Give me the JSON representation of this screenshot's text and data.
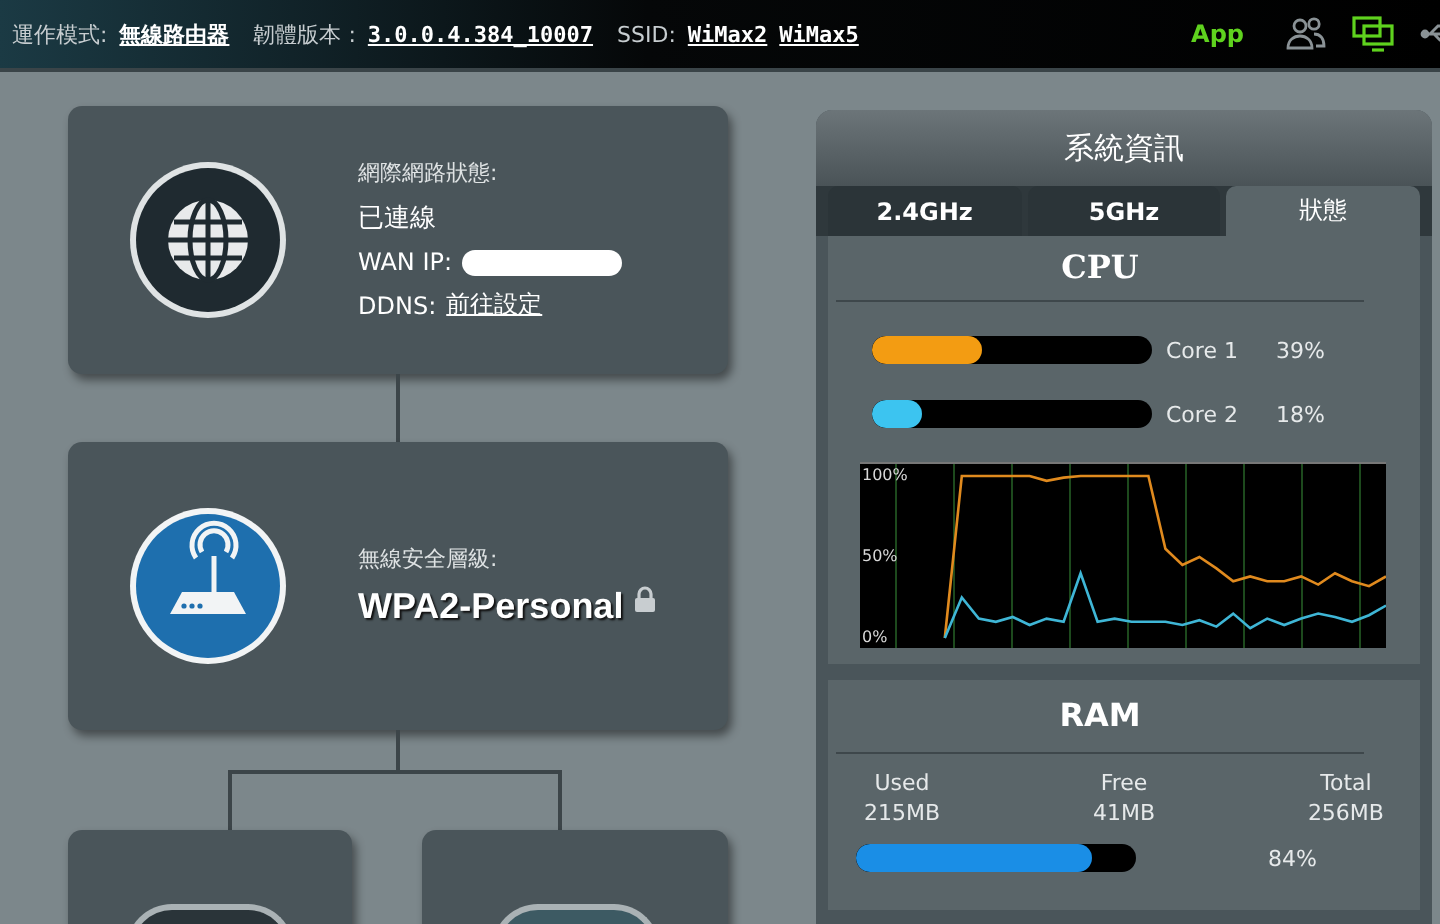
{
  "top_bar": {
    "mode_label": "運作模式:",
    "mode": "無線路由器",
    "firmware_label": "韌體版本 :",
    "firmware": "3.0.0.4.384_10007",
    "ssid_label": "SSID:",
    "ssids": [
      "WiMax2",
      "WiMax5"
    ],
    "app": "App"
  },
  "internet_card": {
    "status_label": "網際網路狀態:",
    "status": "已連線",
    "wan_ip_label": "WAN IP:",
    "ddns_label": "DDNS:",
    "ddns_link": "前往設定"
  },
  "wireless_card": {
    "security_label": "無線安全層級:",
    "security": "WPA2-Personal"
  },
  "system_panel": {
    "title": "系統資訊",
    "tabs": [
      {
        "label": "2.4GHz",
        "selected": false
      },
      {
        "label": "5GHz",
        "selected": false
      },
      {
        "label": "狀態",
        "selected": true
      }
    ],
    "cpu": {
      "title": "CPU",
      "cores": [
        {
          "name": "Core 1",
          "level": 0.39,
          "reading": "39%",
          "color": "#f39c12"
        },
        {
          "name": "Core 2",
          "level": 0.18,
          "reading": "18%",
          "color": "#3cc4f0"
        }
      ],
      "chart_data": {
        "type": "line",
        "grid": true,
        "ylim": [
          -6.2,
          107.4
        ],
        "yticks": [
          {
            "value": 0,
            "label": "0%"
          },
          {
            "value": 50,
            "label": "50%"
          },
          {
            "value": 100,
            "label": "100%"
          }
        ],
        "series": [
          {
            "color": "#e08a1e",
            "values": [
              null,
              null,
              null,
              null,
              null,
              0,
              100,
              100,
              100,
              100,
              100,
              97,
              99,
              100,
              100,
              100,
              100,
              100,
              55,
              45,
              50,
              43,
              35,
              38,
              35,
              35,
              38,
              33,
              40,
              35,
              32,
              38
            ]
          },
          {
            "color": "#3fb6d6",
            "values": [
              null,
              null,
              null,
              null,
              null,
              0,
              25,
              12,
              10,
              13,
              8,
              12,
              10,
              40,
              10,
              12,
              10,
              10,
              10,
              8,
              11,
              7,
              15,
              6,
              12,
              8,
              12,
              15,
              13,
              10,
              14,
              20
            ]
          }
        ]
      }
    },
    "ram": {
      "title": "RAM",
      "stats": [
        {
          "label": "Used",
          "value": "215MB"
        },
        {
          "label": "Free",
          "value": "41MB"
        },
        {
          "label": "Total",
          "value": "256MB"
        }
      ],
      "level": 0.84,
      "reading": "84%"
    }
  }
}
